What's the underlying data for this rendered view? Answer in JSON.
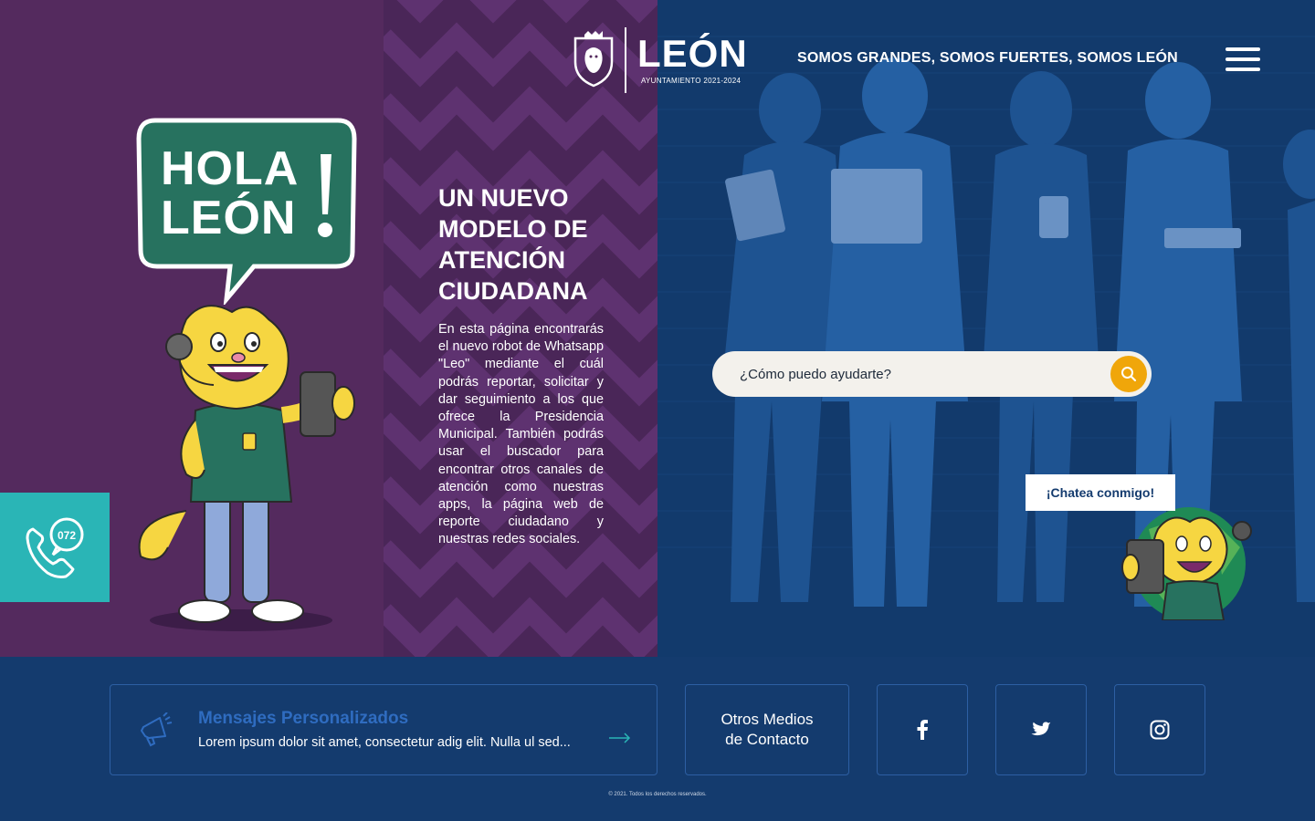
{
  "header": {
    "logo_name": "LEÓN",
    "logo_sub": "AYUNTAMIENTO 2021-2024",
    "tagline": "SOMOS GRANDES, SOMOS FUERTES, SOMOS LEÓN",
    "menu_icon": "hamburger-menu-icon"
  },
  "hero": {
    "bubble_line1": "HOLA",
    "bubble_line2": "LEÓN",
    "title": "UN NUEVO MODELO DE ATENCIÓN CIUDADANA",
    "description": "En esta página encontrarás el nuevo robot de Whatsapp \"Leo\" mediante el cuál podrás reportar, solicitar y dar seguimiento a los que ofrece la Presidencia Municipal. También podrás usar el buscador para encontrar otros canales de atención como nuestras apps, la página web de reporte ciudadano y nuestras redes sociales.",
    "call_number": "072"
  },
  "search": {
    "placeholder": "¿Cómo puedo ayudarte?",
    "icon": "search-icon"
  },
  "chat": {
    "label": "¡Chatea conmigo!"
  },
  "footer": {
    "message_title": "Mensajes Personalizados",
    "message_body": "Lorem ipsum dolor sit amet, consectetur adig elit. Nulla ul sed...",
    "contact_label_line1": "Otros Medios",
    "contact_label_line2": "de Contacto",
    "social": [
      "facebook-icon",
      "twitter-icon",
      "instagram-icon"
    ],
    "copyright": "© 2021. Todos los derechos reservados."
  },
  "colors": {
    "purple": "#542a5e",
    "navy": "#143b6e",
    "teal": "#2ab5b6",
    "green": "#27725f",
    "yellow": "#f0a60a",
    "accent_blue": "#2f6cc0"
  }
}
